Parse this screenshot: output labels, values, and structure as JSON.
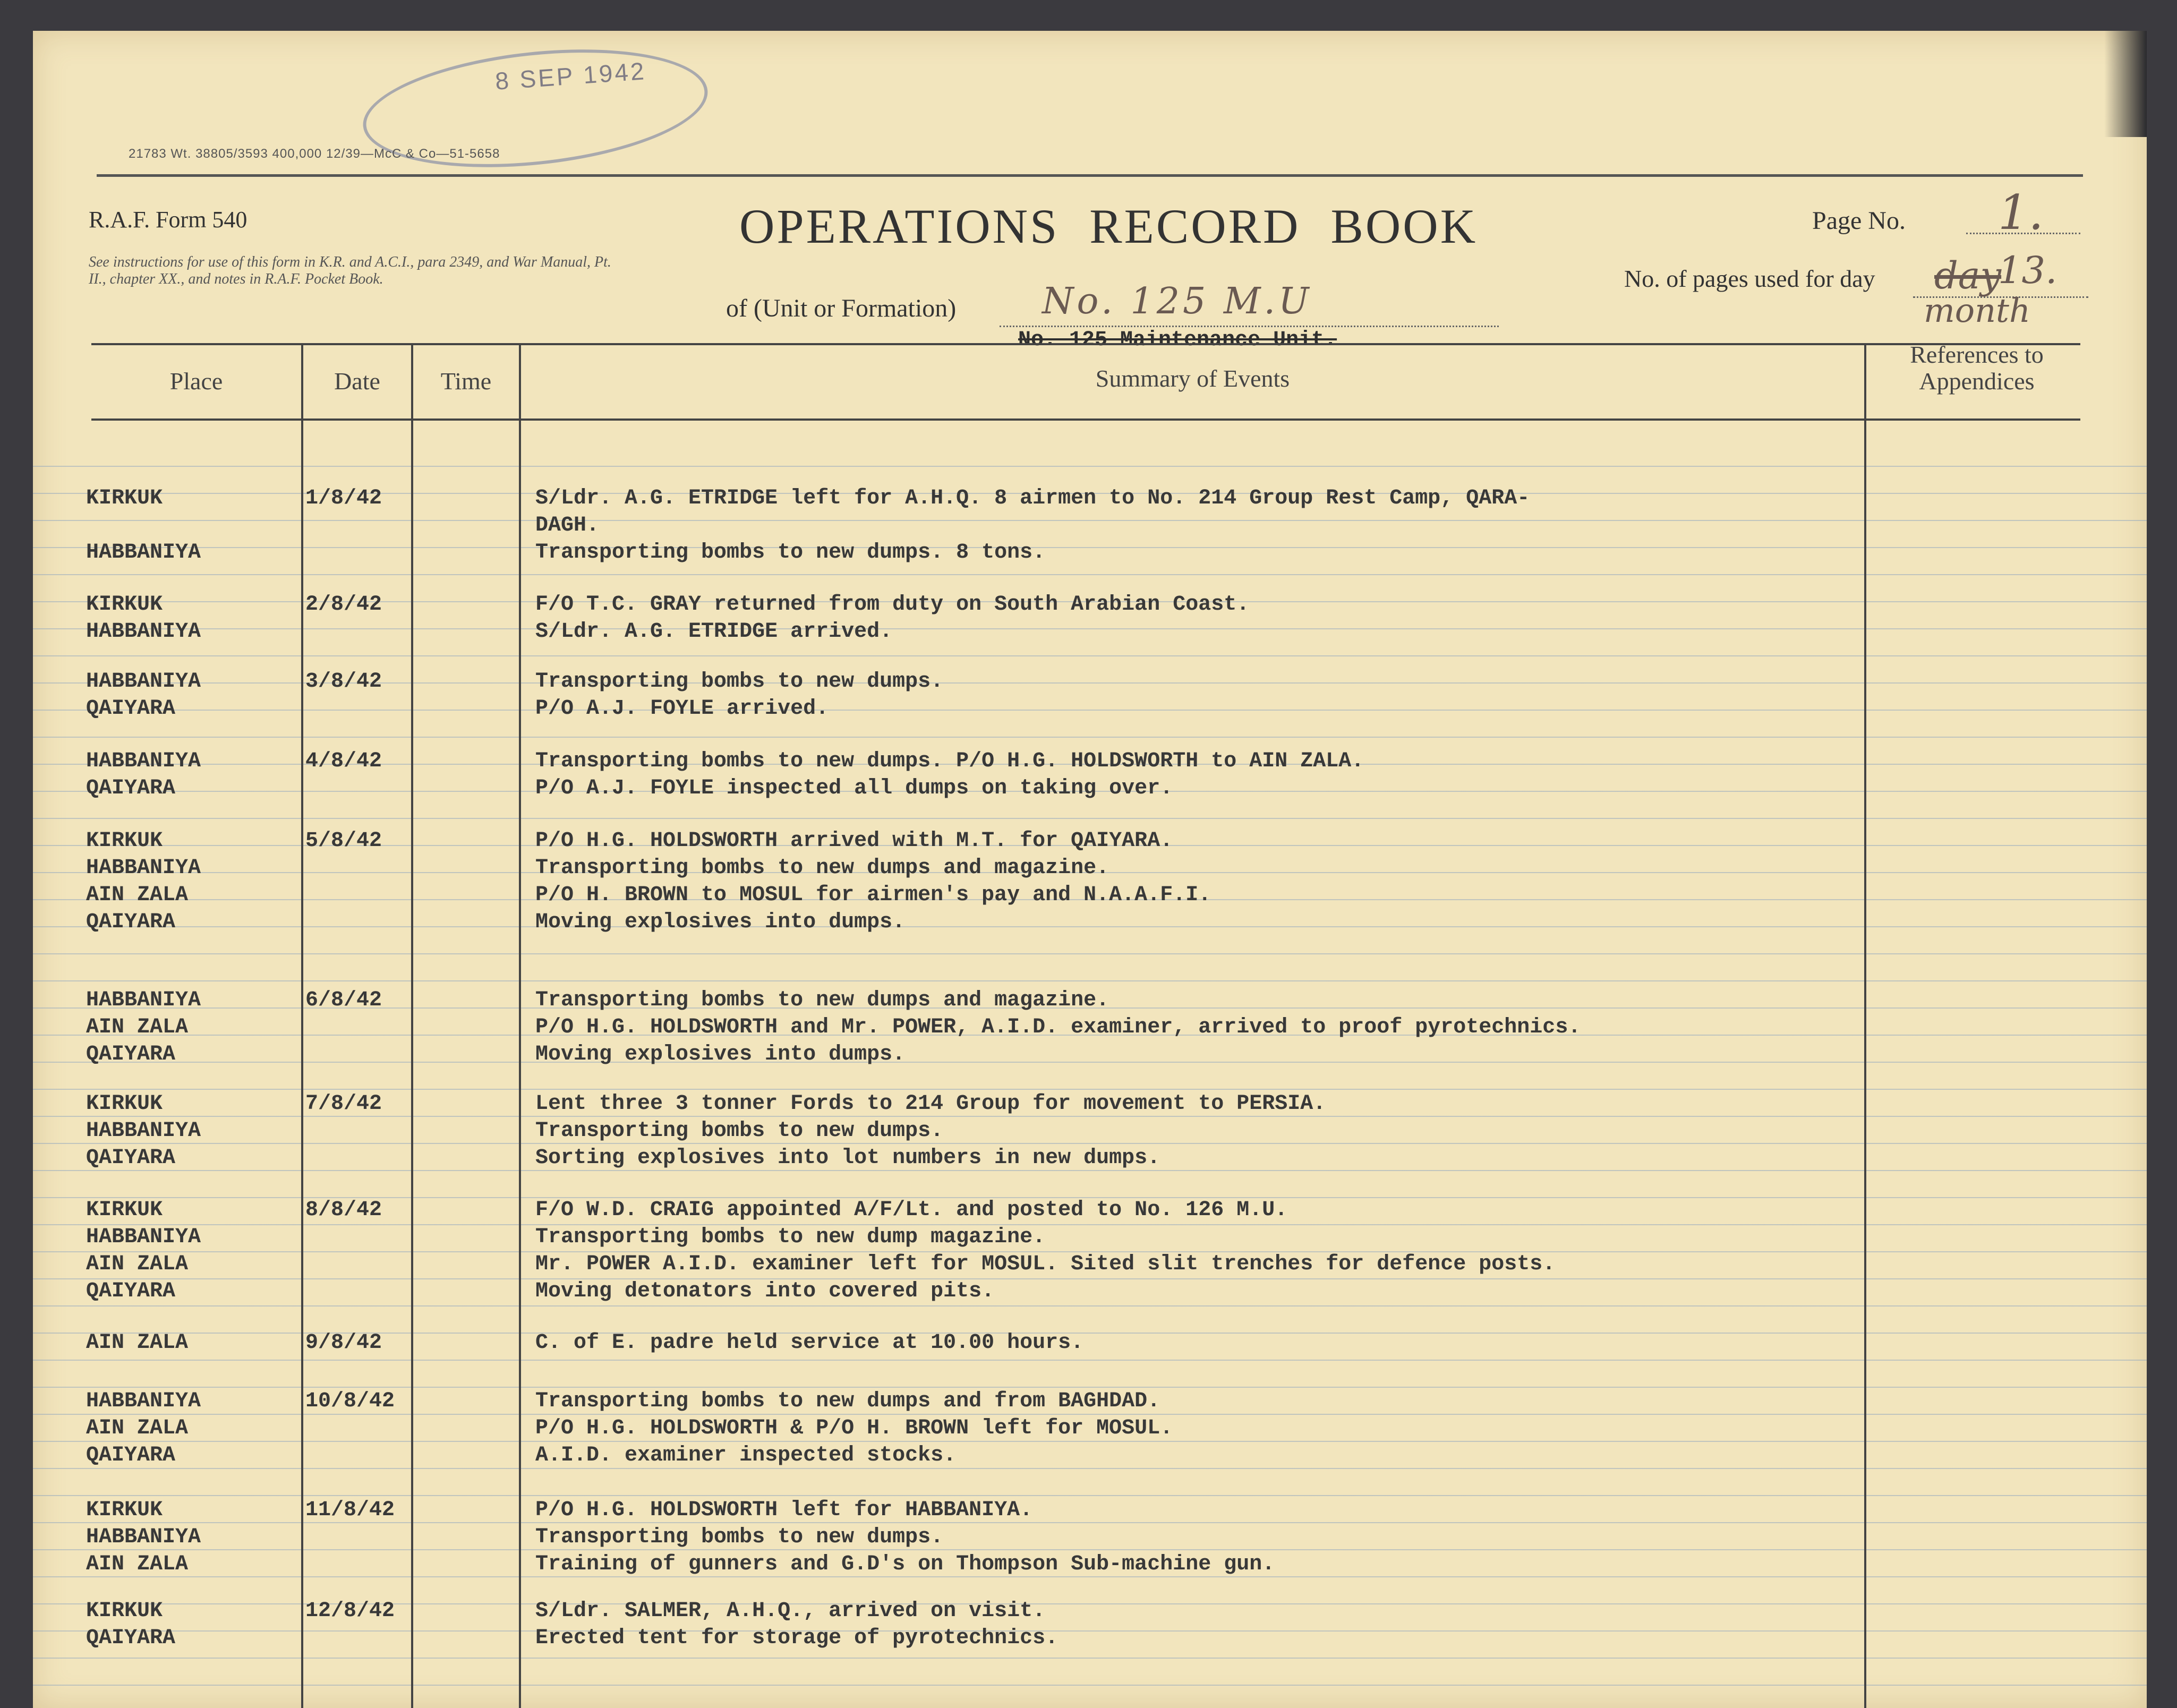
{
  "printer_number": "21783  Wt. 38805/3593  400,000  12/39—McC & Co—51-5658",
  "stamp_date": "8 SEP 1942",
  "form_number": "R.A.F. Form 540",
  "instructions": "See instructions for use of this form in K.R. and A.C.I., para 2349, and War Manual, Pt. II., chapter XX., and notes in R.A.F. Pocket Book.",
  "title": "OPERATIONS RECORD BOOK",
  "page": {
    "label": "Page No.",
    "value": "1."
  },
  "pages_used": {
    "label": "No. of pages used for day",
    "hw_struck": "day",
    "hw_value": "13.",
    "hw_correction": "month"
  },
  "unit": {
    "label": "of (Unit or Formation)",
    "handwritten": "No. 125 M.U",
    "typed_struck": "No. 125 Maintenance Unit."
  },
  "columns": {
    "place": "Place",
    "date": "Date",
    "time": "Time",
    "summary": "Summary of Events",
    "references": "References to Appendices"
  },
  "entries": [
    {
      "places": [
        "KIRKUK",
        "",
        "HABBANIYA"
      ],
      "date": "1/8/42",
      "summary": [
        "S/Ldr. A.G. ETRIDGE left for A.H.Q.   8 airmen to No. 214 Group Rest Camp, QARA-",
        "DAGH.",
        "Transporting bombs to new dumps. 8 tons."
      ]
    },
    {
      "places": [
        "KIRKUK",
        "HABBANIYA"
      ],
      "date": "2/8/42",
      "summary": [
        "F/O T.C. GRAY returned from duty on South Arabian Coast.",
        "S/Ldr. A.G. ETRIDGE arrived."
      ]
    },
    {
      "places": [
        "HABBANIYA",
        "QAIYARA"
      ],
      "date": "3/8/42",
      "summary": [
        "Transporting bombs to new dumps.",
        "P/O A.J. FOYLE arrived."
      ]
    },
    {
      "places": [
        "HABBANIYA",
        "QAIYARA"
      ],
      "date": "4/8/42",
      "summary": [
        "Transporting bombs to new dumps.  P/O H.G. HOLDSWORTH to AIN ZALA.",
        "P/O A.J. FOYLE inspected all dumps on taking over."
      ]
    },
    {
      "places": [
        "KIRKUK",
        "HABBANIYA",
        "AIN ZALA",
        "QAIYARA"
      ],
      "date": "5/8/42",
      "summary": [
        "P/O H.G. HOLDSWORTH arrived with M.T. for QAIYARA.",
        "Transporting bombs to new dumps and magazine.",
        "P/O H. BROWN to MOSUL for airmen's pay and N.A.A.F.I.",
        "Moving explosives into dumps."
      ]
    },
    {
      "places": [
        "HABBANIYA",
        "AIN ZALA",
        "QAIYARA"
      ],
      "date": "6/8/42",
      "summary": [
        "Transporting bombs to new dumps and magazine.",
        "P/O H.G. HOLDSWORTH and Mr. POWER, A.I.D. examiner, arrived to proof pyrotechnics.",
        "Moving explosives into dumps."
      ]
    },
    {
      "places": [
        "KIRKUK",
        "HABBANIYA",
        "QAIYARA"
      ],
      "date": "7/8/42",
      "summary": [
        "Lent three 3 tonner Fords to 214 Group for movement to PERSIA.",
        "Transporting bombs to new dumps.",
        "Sorting explosives into lot numbers in new dumps."
      ]
    },
    {
      "places": [
        "KIRKUK",
        "HABBANIYA",
        "AIN ZALA",
        "QAIYARA"
      ],
      "date": "8/8/42",
      "summary": [
        "F/O W.D. CRAIG appointed A/F/Lt. and posted to No. 126 M.U.",
        "Transporting bombs to new dump magazine.",
        "Mr. POWER A.I.D. examiner left for MOSUL.  Sited slit trenches for defence posts.",
        "Moving detonators into covered pits."
      ]
    },
    {
      "places": [
        "AIN ZALA"
      ],
      "date": "9/8/42",
      "summary": [
        "C. of E. padre held service at 10.00 hours."
      ]
    },
    {
      "places": [
        "HABBANIYA",
        "AIN ZALA",
        "QAIYARA"
      ],
      "date": "10/8/42",
      "summary": [
        "Transporting bombs to new dumps and from BAGHDAD.",
        "P/O H.G. HOLDSWORTH & P/O H. BROWN left for MOSUL.",
        "A.I.D. examiner inspected stocks."
      ]
    },
    {
      "places": [
        "KIRKUK",
        "HABBANIYA",
        "AIN ZALA"
      ],
      "date": "11/8/42",
      "summary": [
        "P/O H.G. HOLDSWORTH left for HABBANIYA.",
        "Transporting bombs to new dumps.",
        "Training of gunners and G.D's on Thompson Sub-machine gun."
      ]
    },
    {
      "places": [
        "KIRKUK",
        "QAIYARA"
      ],
      "date": "12/8/42",
      "summary": [
        "S/Ldr. SALMER, A.H.Q., arrived on visit.",
        "Erected tent for storage of pyrotechnics."
      ]
    }
  ]
}
